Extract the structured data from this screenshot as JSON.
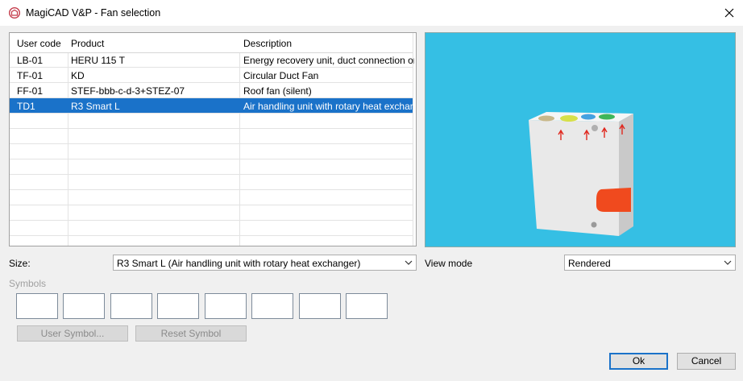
{
  "window": {
    "title": "MagiCAD V&P - Fan selection"
  },
  "table": {
    "headers": [
      "User code",
      "Product",
      "Description"
    ],
    "rows": [
      {
        "code": "LB-01",
        "product": "HERU 115 T",
        "description": "Energy recovery unit, duct connection on t..."
      },
      {
        "code": "TF-01",
        "product": "KD",
        "description": "Circular Duct Fan"
      },
      {
        "code": "FF-01",
        "product": "STEF-bbb-c-d-3+STEZ-07",
        "description": "Roof fan (silent)"
      },
      {
        "code": "TD1",
        "product": "R3 Smart L",
        "description": "Air handling unit with rotary heat exchanger",
        "selected": true
      }
    ]
  },
  "size": {
    "label": "Size:",
    "value": "R3 Smart L (Air handling unit with rotary heat exchanger)"
  },
  "view_mode": {
    "label": "View mode",
    "value": "Rendered"
  },
  "symbols": {
    "label": "Symbols"
  },
  "buttons": {
    "user_symbol": "User Symbol...",
    "reset_symbol": "Reset Symbol",
    "ok": "Ok",
    "cancel": "Cancel"
  },
  "colors": {
    "accent": "#1a72c9",
    "viewer_bg": "#35bfe4",
    "unit_accent": "#f04a1e"
  }
}
